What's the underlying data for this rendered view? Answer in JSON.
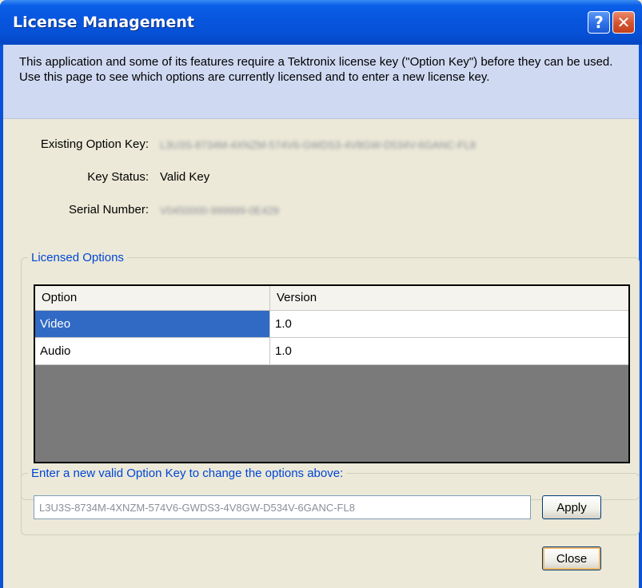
{
  "window": {
    "title": "License Management",
    "help_glyph": "?",
    "close_glyph": "✕"
  },
  "banner": {
    "text": "This application and some of its features require a Tektronix license key (\"Option Key\") before they can be used. Use this page to see which options are currently licensed and to enter a new license key."
  },
  "info": {
    "existing_key_label": "Existing Option Key:",
    "existing_key_value": "L3U3S-8734M-4XNZM-574V6-GWDS3-4V8GW-D534V-6GANC-FL8",
    "key_status_label": "Key Status:",
    "key_status_value": "Valid Key",
    "serial_label": "Serial Number:",
    "serial_value": "V0450000-999999-0E429"
  },
  "licensed_options": {
    "legend": "Licensed Options",
    "columns": [
      "Option",
      "Version"
    ],
    "rows": [
      {
        "option": "Video",
        "version": "1.0",
        "selected": true
      },
      {
        "option": "Audio",
        "version": "1.0",
        "selected": false
      }
    ]
  },
  "new_key": {
    "legend": "Enter a new valid Option Key to change the options above:",
    "input_value": "L3U3S-8734M-4XNZM-574V6-GWDS3-4V8GW-D534V-6GANC-FL8",
    "apply_label": "Apply"
  },
  "footer": {
    "close_label": "Close"
  },
  "colors": {
    "title_bar": "#0a5fe8",
    "selection": "#316ac5",
    "legend_text": "#0046d5",
    "banner_bg": "#cfd9f2",
    "grid_empty": "#7a7a7a"
  }
}
